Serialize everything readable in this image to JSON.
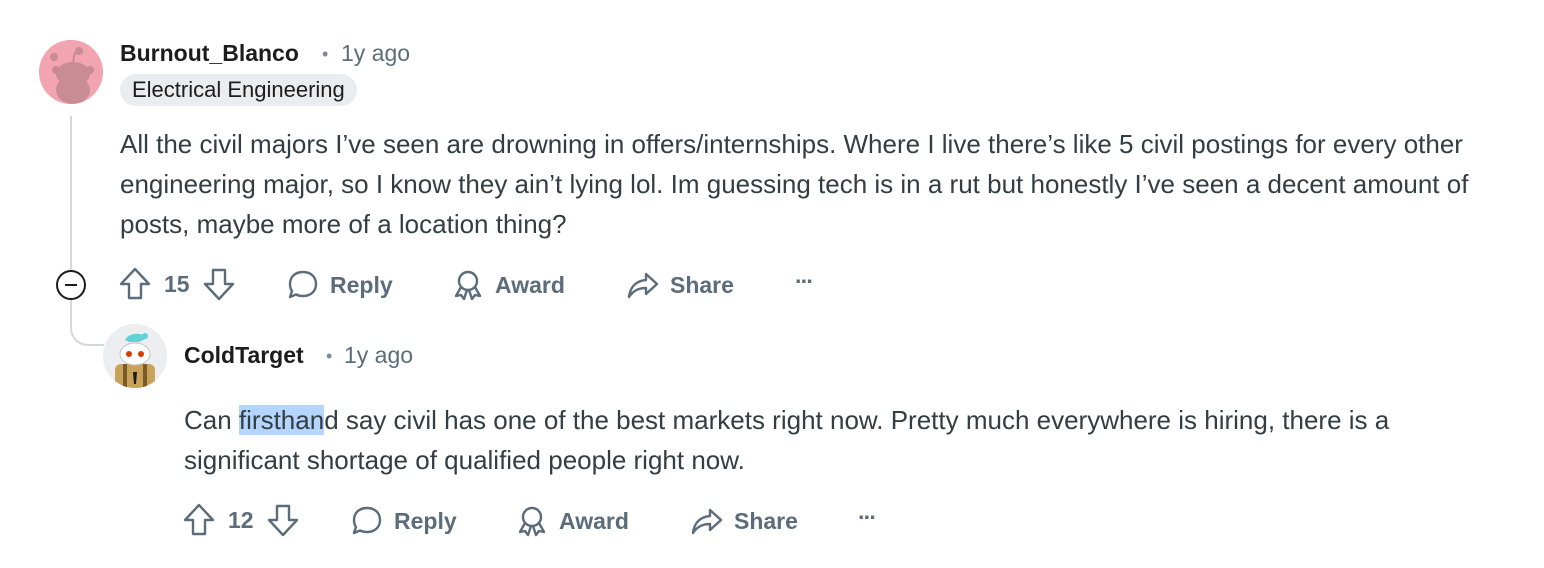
{
  "comments": [
    {
      "username": "Burnout_Blanco",
      "separator": "•",
      "time": "1y ago",
      "flair": "Electrical Engineering",
      "body": "All the civil majors I’ve seen are drowning in offers/internships. Where I live there’s like 5 civil postings for every other engineering major, so I know they ain’t lying lol. Im guessing tech is in a rut but honestly I’ve seen a decent amount of posts, maybe more of a location thing?",
      "score": "15",
      "reply_label": "Reply",
      "award_label": "Award",
      "share_label": "Share",
      "more_label": "···",
      "avatar_color": "#f2a5b0"
    },
    {
      "username": "ColdTarget",
      "separator": "•",
      "time": "1y ago",
      "body_before": "Can ",
      "body_selected": "firsthan",
      "body_after": "d say civil has one of the best markets right now. Pretty much everywhere is hiring, there is a significant shortage of qualified people right now.",
      "score": "12",
      "reply_label": "Reply",
      "award_label": "Award",
      "share_label": "Share",
      "more_label": "···"
    }
  ],
  "colors": {
    "selection": "#b4d5fe",
    "meta_text": "#5c6c7a",
    "body_text": "#333d42",
    "thread_line": "#d4d7d9"
  }
}
